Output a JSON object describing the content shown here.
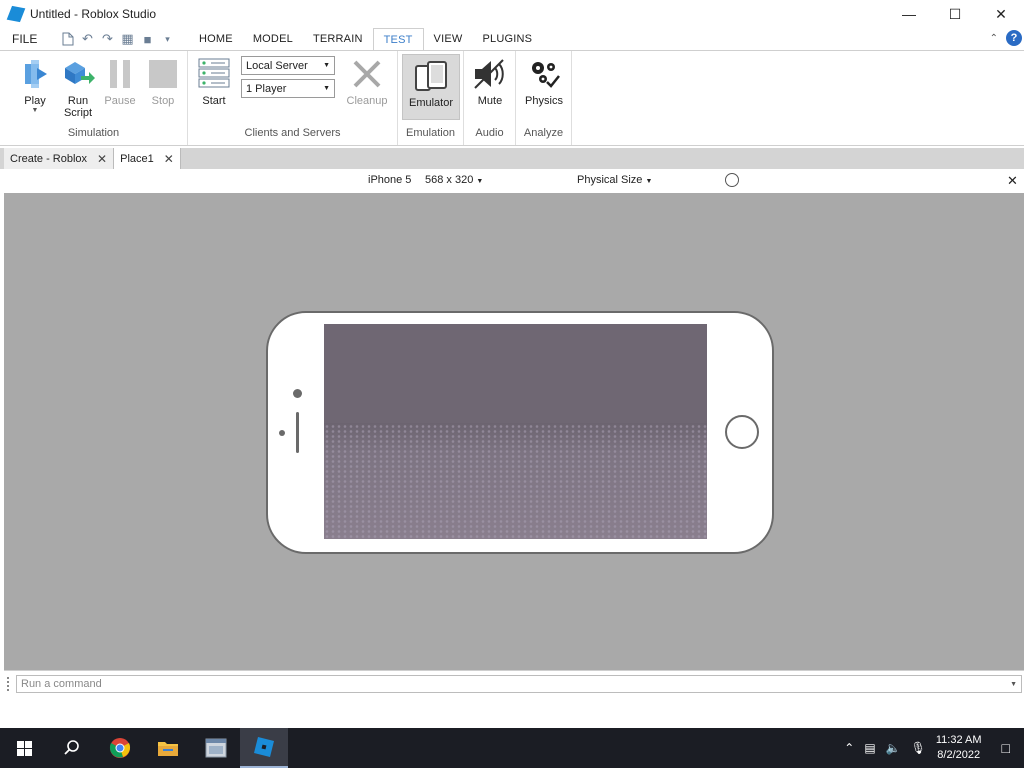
{
  "window": {
    "title": "Untitled - Roblox Studio"
  },
  "menu": {
    "file_label": "FILE",
    "tabs": [
      {
        "label": "HOME"
      },
      {
        "label": "MODEL"
      },
      {
        "label": "TERRAIN"
      },
      {
        "label": "TEST"
      },
      {
        "label": "VIEW"
      },
      {
        "label": "PLUGINS"
      }
    ],
    "active_tab": "TEST"
  },
  "ribbon": {
    "simulation": {
      "label": "Simulation",
      "play": "Play",
      "run_script_line1": "Run",
      "run_script_line2": "Script",
      "pause": "Pause",
      "stop": "Stop"
    },
    "clients": {
      "label": "Clients and Servers",
      "start": "Start",
      "server_select": "Local Server",
      "players_select": "1 Player",
      "cleanup": "Cleanup"
    },
    "emulation": {
      "label": "Emulation",
      "emulator": "Emulator"
    },
    "audio": {
      "label": "Audio",
      "mute": "Mute"
    },
    "analyze": {
      "label": "Analyze",
      "physics": "Physics"
    }
  },
  "doc_tabs": [
    {
      "label": "Create - Roblox"
    },
    {
      "label": "Place1"
    }
  ],
  "emulator_bar": {
    "device": "iPhone 5",
    "resolution": "568 x 320",
    "size_mode": "Physical Size"
  },
  "command_bar": {
    "placeholder": "Run a command"
  },
  "taskbar": {
    "time": "11:32 AM",
    "date": "8/2/2022"
  },
  "colors": {
    "accent": "#3b7ec9",
    "viewport_bg": "#a9a9a9",
    "taskbar_bg": "#1b1d24"
  }
}
